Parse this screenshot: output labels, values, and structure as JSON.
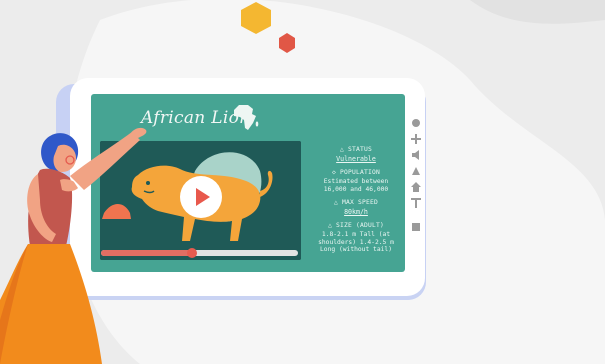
{
  "lesson": {
    "title": "African Lion"
  },
  "video": {
    "progress_fraction": 0.46
  },
  "facts": [
    {
      "heading": "△ STATUS",
      "value": "Vulnerable"
    },
    {
      "heading": "◇ POPULATION",
      "value": "Estimated between 16,000 and 46,000"
    },
    {
      "heading": "△ MAX SPEED",
      "value": "80km/h"
    },
    {
      "heading": "△ SIZE (ADULT)",
      "value": "1.8-2.1 m Tall (at shoulders) 1.4-2.5 m Long (without tail)"
    }
  ],
  "icons": {
    "africa": "africa-map-icon",
    "play": "play-icon",
    "tools": [
      "dot-icon",
      "plus-icon",
      "speaker-icon",
      "triangle-icon",
      "home-icon",
      "text-icon",
      "square-icon"
    ]
  },
  "colors": {
    "board": "#46a493",
    "video_bg": "#1f5a57",
    "accent_red": "#e16e63",
    "lion": "#f4a53a"
  }
}
